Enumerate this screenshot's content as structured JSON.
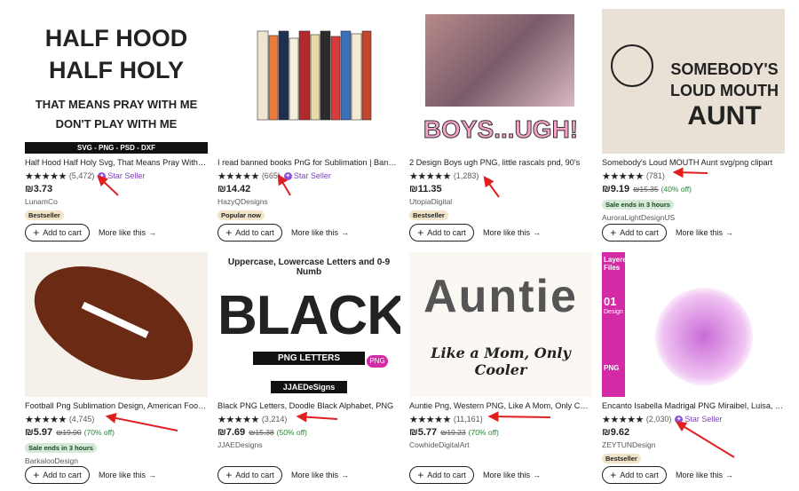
{
  "listings": [
    {
      "title": "Half Hood Half Holy Svg, That Means Pray With Me Don't Play With Me",
      "rating_stars": "★★★★★",
      "review_count": "(5,472)",
      "star_seller": true,
      "price": "₪3.73",
      "original_price": "",
      "discount": "",
      "sale_badge": "",
      "shop": "LunamCo",
      "badge": "Bestseller",
      "image": {
        "lines": [
          "HALF HOOD",
          "HALF HOLY",
          "THAT MEANS PRAY WITH ME",
          "DON'T PLAY WITH ME"
        ],
        "footer": "SVG - PNG - PSD - DXF"
      }
    },
    {
      "title": "I read banned books PnG for Sublimation | Banned Books",
      "rating_stars": "★★★★★",
      "review_count": "(665)",
      "star_seller": true,
      "price": "₪14.42",
      "original_price": "",
      "discount": "",
      "sale_badge": "",
      "shop": "HazyQDesigns",
      "badge": "Popular now",
      "image": {
        "lines": []
      }
    },
    {
      "title": "2 Design Boys ugh PNG, little rascals pnd, 90's",
      "rating_stars": "★★★★★",
      "review_count": "(1,283)",
      "star_seller": false,
      "price": "₪11.35",
      "original_price": "",
      "discount": "",
      "sale_badge": "",
      "shop": "UtopiaDigital",
      "badge": "Bestseller",
      "image": {
        "lines": [
          "BOYS...UGH!"
        ]
      }
    },
    {
      "title": "Somebody's Loud MOUTH Aunt svg/png clipart",
      "rating_stars": "★★★★★",
      "review_count": "(781)",
      "star_seller": false,
      "price": "₪9.19",
      "original_price": "₪15.35",
      "discount": "(40% off)",
      "sale_badge": "Sale ends in 3 hours",
      "shop": "AuroraLightDesignUS",
      "badge": "",
      "image": {
        "lines": [
          "SOMEBODY'S",
          "LOUD MOUTH",
          "AUNT"
        ],
        "small": "LOUD MOUTH AUNT"
      }
    },
    {
      "title": "Football Png Sublimation Design, American Football",
      "rating_stars": "★★★★★",
      "review_count": "(4,745)",
      "star_seller": false,
      "price": "₪5.97",
      "original_price": "₪19.90",
      "discount": "(70% off)",
      "sale_badge": "Sale ends in 3 hours",
      "shop": "BarkalooDesign",
      "badge": "",
      "image": {
        "lines": []
      }
    },
    {
      "title": "Black PNG Letters, Doodle Black Alphabet, PNG",
      "rating_stars": "★★★★★",
      "review_count": "(3,214)",
      "star_seller": false,
      "price": "₪7.69",
      "original_price": "₪15.38",
      "discount": "(50% off)",
      "sale_badge": "",
      "shop": "JJAEDesigns",
      "badge": "",
      "image": {
        "lines": [
          "Uppercase, Lowercase Letters and 0-9 Numb",
          "BLACK",
          "PNG LETTERS",
          "PNG",
          "JJAEDeSigns"
        ]
      }
    },
    {
      "title": "Auntie Png, Western PNG, Like A Mom, Only Cooler",
      "rating_stars": "★★★★★",
      "review_count": "(11,161)",
      "star_seller": false,
      "price": "₪5.77",
      "original_price": "₪19.23",
      "discount": "(70% off)",
      "sale_badge": "",
      "shop": "CowhideDigitalArt",
      "badge": "",
      "image": {
        "lines": [
          "Auntie",
          "Like a Mom, Only Cooler"
        ]
      }
    },
    {
      "title": "Encanto Isabella Madrigal PNG Miraibel, Luisa, Mirabel",
      "rating_stars": "★★★★★",
      "review_count": "(2,030)",
      "star_seller": true,
      "price": "₪9.62",
      "original_price": "",
      "discount": "",
      "sale_badge": "",
      "shop": "ZEYTUNDesign",
      "badge": "Bestseller",
      "image": {
        "lines": [
          "Layered Files",
          "01",
          "Design",
          "PNG"
        ]
      }
    }
  ],
  "labels": {
    "add_to_cart": "Add to cart",
    "more_like_this": "More like this",
    "star_seller": "Star Seller"
  },
  "colors": {
    "annotation_arrow": "#e02020",
    "star_seller": "#7c3fbf",
    "sale_badge_bg": "#d4e9d7",
    "bestseller_bg": "#f1e4c9"
  }
}
